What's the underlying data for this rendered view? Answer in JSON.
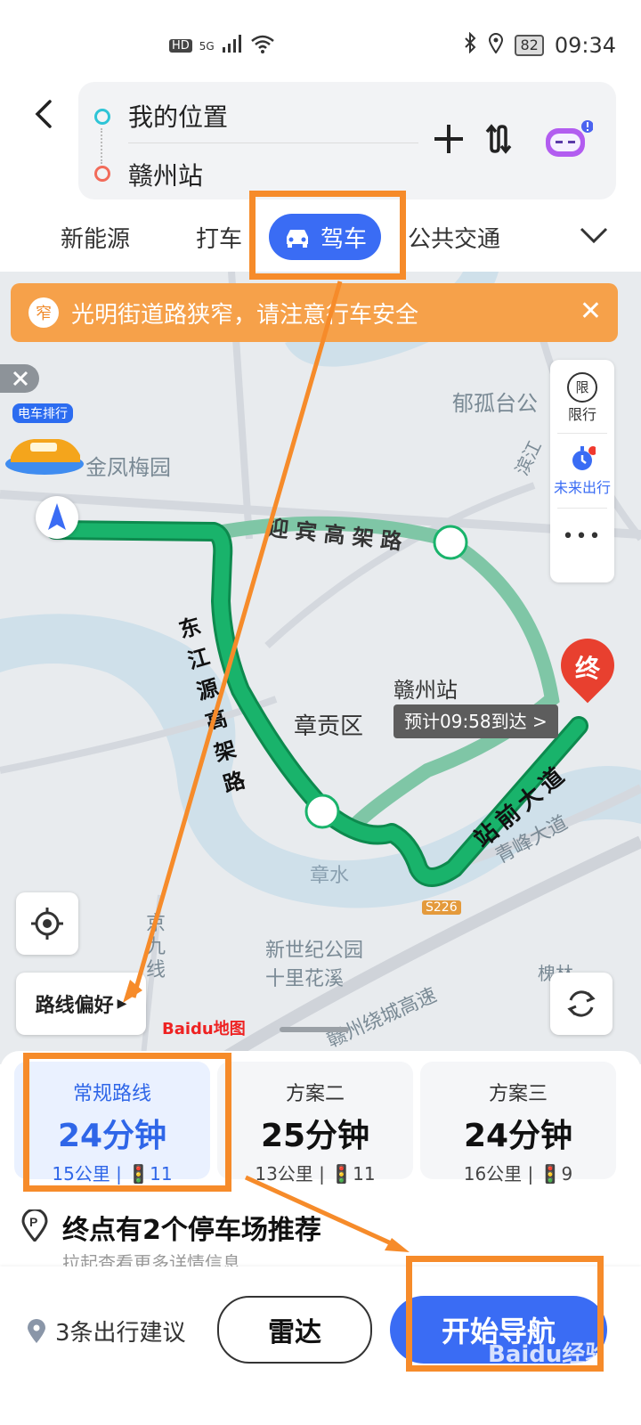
{
  "status_bar": {
    "network": "HD",
    "signal": "5G",
    "battery": "82",
    "time": "09:34"
  },
  "route_input": {
    "origin": "我的位置",
    "destination": "赣州站"
  },
  "mode_tabs": [
    "新能源",
    "打车",
    "驾车",
    "公共交通"
  ],
  "active_mode": "驾车",
  "alert_banner": {
    "badge": "窄",
    "text": "光明街道路狭窄，请注意行车安全"
  },
  "map": {
    "labels": {
      "jinfeng": "金凤梅园",
      "yugutai": "郁孤台公",
      "yingbin": "迎宾高架路",
      "dongjiang": "东江源高架路",
      "zhanggong": "章贡区",
      "ganzhou_station": "赣州站",
      "zhanqian": "站前大道",
      "qingfeng": "青峰大道",
      "zhangshui": "章水",
      "s226": "S226",
      "jingaoxian": "京九线",
      "xinshiji": "新世纪公园",
      "shilihuaxi": "十里花溪",
      "raocheng": "赣州绕城高速",
      "taojiang": "滨江",
      "huai": "槐林"
    },
    "ev_rank_label": "电车排行",
    "eta_callout": "预计09:58到达 >",
    "end_marker": "终",
    "route_pref": "路线偏好",
    "baidu_logo": "Baidu地图",
    "side_tools": {
      "restrict_icon": "限",
      "restrict_label": "限行",
      "future_label": "未来出行",
      "more": "•••"
    }
  },
  "routes": [
    {
      "name": "常规路线",
      "duration": "24分钟",
      "distance": "15公里",
      "lights": "11"
    },
    {
      "name": "方案二",
      "duration": "25分钟",
      "distance": "13公里",
      "lights": "11"
    },
    {
      "name": "方案三",
      "duration": "24分钟",
      "distance": "16公里",
      "lights": "9"
    }
  ],
  "parking": {
    "title": "终点有2个停车场推荐",
    "subtitle": "拉起查看更多详情信息"
  },
  "footer": {
    "suggestions": "3条出行建议",
    "radar": "雷达",
    "start": "开始导航"
  },
  "watermark": "Baidu经验",
  "colors": {
    "accent": "#3a6cf4",
    "route": "#19b36b",
    "alt_route": "#7fc6a6",
    "banner": "#f6a14a",
    "annotation": "#f68b2a",
    "destination": "#e8402f"
  }
}
